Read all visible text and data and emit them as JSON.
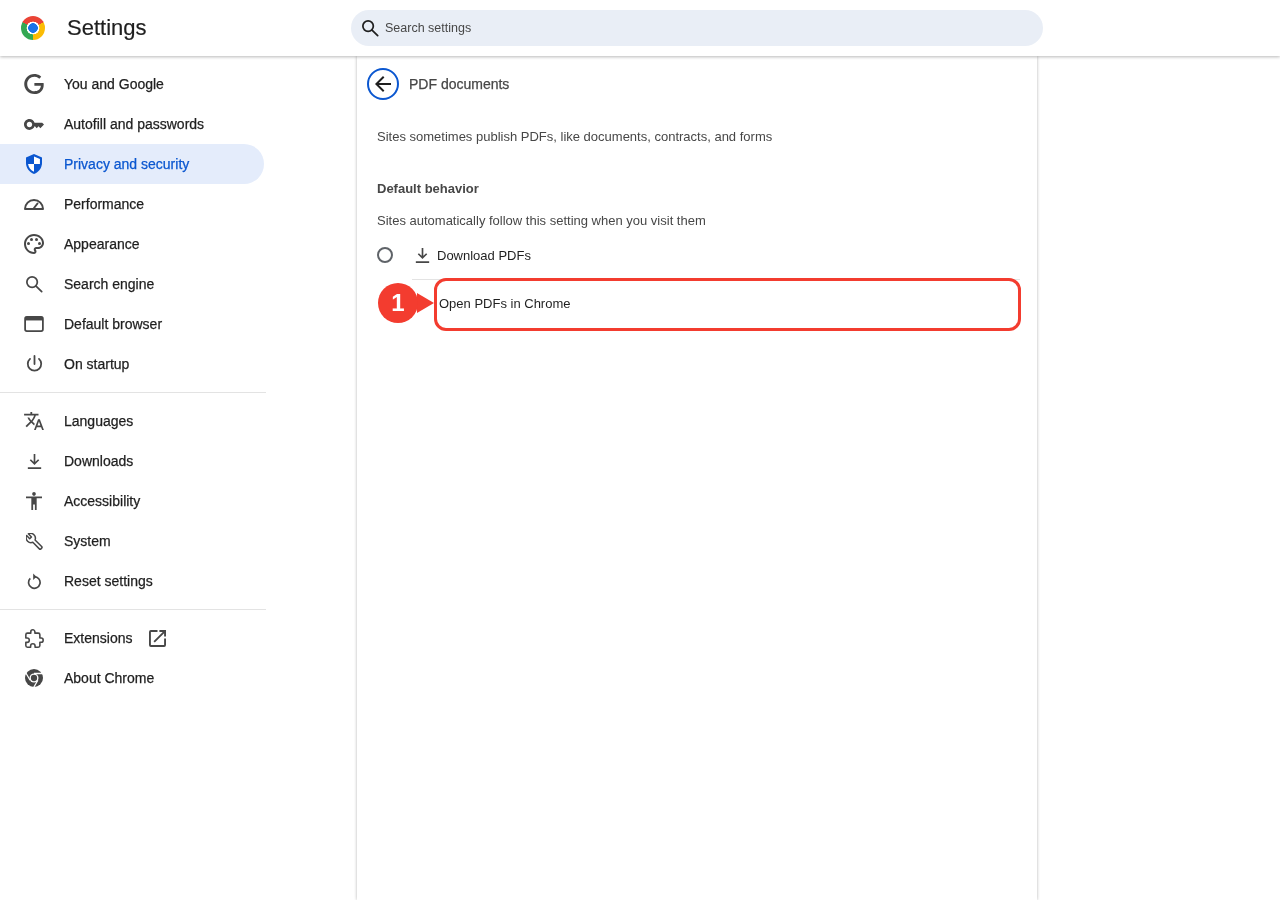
{
  "header": {
    "title": "Settings",
    "search": {
      "placeholder": "Search settings"
    }
  },
  "sidebar": {
    "groups": [
      {
        "items": [
          {
            "label": "You and Google",
            "selected": false,
            "external": false
          },
          {
            "label": "Autofill and passwords",
            "selected": false,
            "external": false
          },
          {
            "label": "Privacy and security",
            "selected": true,
            "external": false
          },
          {
            "label": "Performance",
            "selected": false,
            "external": false
          },
          {
            "label": "Appearance",
            "selected": false,
            "external": false
          },
          {
            "label": "Search engine",
            "selected": false,
            "external": false
          },
          {
            "label": "Default browser",
            "selected": false,
            "external": false
          },
          {
            "label": "On startup",
            "selected": false,
            "external": false
          }
        ]
      },
      {
        "items": [
          {
            "label": "Languages",
            "selected": false,
            "external": false
          },
          {
            "label": "Downloads",
            "selected": false,
            "external": false
          },
          {
            "label": "Accessibility",
            "selected": false,
            "external": false
          },
          {
            "label": "System",
            "selected": false,
            "external": false
          },
          {
            "label": "Reset settings",
            "selected": false,
            "external": false
          }
        ]
      },
      {
        "items": [
          {
            "label": "Extensions",
            "selected": false,
            "external": true
          },
          {
            "label": "About Chrome",
            "selected": false,
            "external": false
          }
        ]
      }
    ]
  },
  "page": {
    "title": "PDF documents",
    "description": "Sites sometimes publish PDFs, like documents, contracts, and forms",
    "section": {
      "heading": "Default behavior",
      "description": "Sites automatically follow this setting when you visit them",
      "options": [
        {
          "kind": "radio",
          "label": "Download PDFs",
          "selected": false
        },
        {
          "kind": "covered",
          "label": "Open PDFs in Chrome",
          "callout": "1"
        }
      ]
    }
  }
}
